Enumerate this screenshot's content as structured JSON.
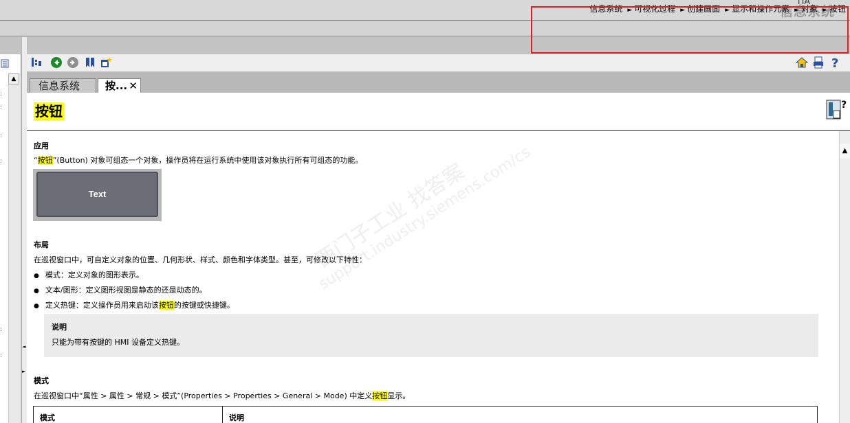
{
  "header": {
    "app_abbr": "TIA",
    "title": "信息系统"
  },
  "breadcrumb": [
    "信息系统",
    "可视化过程",
    "创建画面",
    "显示和操作元素",
    "对象",
    "按钮"
  ],
  "breadcrumb_separator": "►",
  "tabs": [
    {
      "label": "信息系统",
      "active": false
    },
    {
      "label": "按...",
      "active": true,
      "close": "✕"
    }
  ],
  "toolbar": {
    "left_icons": [
      "sync-toc-icon",
      "back-icon",
      "forward-icon",
      "bookmark-icon",
      "new-window-icon"
    ],
    "right_icons": [
      "home-icon",
      "print-icon",
      "help-icon"
    ]
  },
  "page": {
    "title": "按钮",
    "help_icon_glyph": "?"
  },
  "content": {
    "application_heading": "应用",
    "application_text_pre": "“",
    "application_text_hl": "按钮",
    "application_text_post": "”(Button) 对象可组态一个对象，操作员将在运行系统中使用该对象执行所有可组态的功能。",
    "sample_button_label": "Text",
    "layout_heading": "布局",
    "layout_text": "在巡视窗口中，可自定义对象的位置、几何形状、样式、颜色和字体类型。甚至，可修改以下特性：",
    "bullets": [
      {
        "pre": "模式：定义对象的图形表示。",
        "hl": "",
        "post": ""
      },
      {
        "pre": "文本/图形：定义图形视图是静态的还是动态的。",
        "hl": "",
        "post": ""
      },
      {
        "pre": "定义热键：定义操作员用来启动该",
        "hl": "按钮",
        "post": "的按键或快捷键。"
      }
    ],
    "note_title": "说明",
    "note_text": "只能为带有按键的 HMI 设备定义热键。",
    "mode_heading": "模式",
    "mode_text_pre": "在巡视窗口中“属性 > 属性 > 常规 > 模式”(Properties > Properties > General > Mode) 中定义",
    "mode_text_hl": "按钮",
    "mode_text_post": "显示。",
    "table_headers": [
      "模式",
      "说明"
    ]
  },
  "watermark": {
    "line1": "西门子工业 找答案",
    "line2": "support.industry.siemens.com/cs"
  },
  "colors": {
    "highlight": "#ffff00",
    "annotation_box": "#e02020",
    "sample_button": "#6b6e77"
  }
}
